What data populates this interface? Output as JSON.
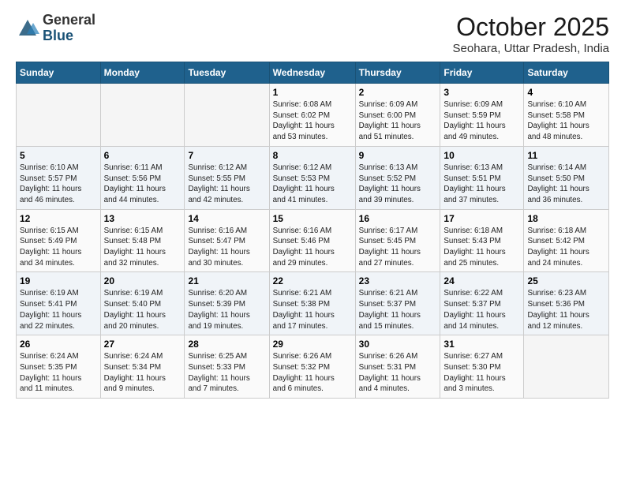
{
  "header": {
    "logo_general": "General",
    "logo_blue": "Blue",
    "month_title": "October 2025",
    "location": "Seohara, Uttar Pradesh, India"
  },
  "weekdays": [
    "Sunday",
    "Monday",
    "Tuesday",
    "Wednesday",
    "Thursday",
    "Friday",
    "Saturday"
  ],
  "weeks": [
    [
      {
        "day": "",
        "info": ""
      },
      {
        "day": "",
        "info": ""
      },
      {
        "day": "",
        "info": ""
      },
      {
        "day": "1",
        "info": "Sunrise: 6:08 AM\nSunset: 6:02 PM\nDaylight: 11 hours\nand 53 minutes."
      },
      {
        "day": "2",
        "info": "Sunrise: 6:09 AM\nSunset: 6:00 PM\nDaylight: 11 hours\nand 51 minutes."
      },
      {
        "day": "3",
        "info": "Sunrise: 6:09 AM\nSunset: 5:59 PM\nDaylight: 11 hours\nand 49 minutes."
      },
      {
        "day": "4",
        "info": "Sunrise: 6:10 AM\nSunset: 5:58 PM\nDaylight: 11 hours\nand 48 minutes."
      }
    ],
    [
      {
        "day": "5",
        "info": "Sunrise: 6:10 AM\nSunset: 5:57 PM\nDaylight: 11 hours\nand 46 minutes."
      },
      {
        "day": "6",
        "info": "Sunrise: 6:11 AM\nSunset: 5:56 PM\nDaylight: 11 hours\nand 44 minutes."
      },
      {
        "day": "7",
        "info": "Sunrise: 6:12 AM\nSunset: 5:55 PM\nDaylight: 11 hours\nand 42 minutes."
      },
      {
        "day": "8",
        "info": "Sunrise: 6:12 AM\nSunset: 5:53 PM\nDaylight: 11 hours\nand 41 minutes."
      },
      {
        "day": "9",
        "info": "Sunrise: 6:13 AM\nSunset: 5:52 PM\nDaylight: 11 hours\nand 39 minutes."
      },
      {
        "day": "10",
        "info": "Sunrise: 6:13 AM\nSunset: 5:51 PM\nDaylight: 11 hours\nand 37 minutes."
      },
      {
        "day": "11",
        "info": "Sunrise: 6:14 AM\nSunset: 5:50 PM\nDaylight: 11 hours\nand 36 minutes."
      }
    ],
    [
      {
        "day": "12",
        "info": "Sunrise: 6:15 AM\nSunset: 5:49 PM\nDaylight: 11 hours\nand 34 minutes."
      },
      {
        "day": "13",
        "info": "Sunrise: 6:15 AM\nSunset: 5:48 PM\nDaylight: 11 hours\nand 32 minutes."
      },
      {
        "day": "14",
        "info": "Sunrise: 6:16 AM\nSunset: 5:47 PM\nDaylight: 11 hours\nand 30 minutes."
      },
      {
        "day": "15",
        "info": "Sunrise: 6:16 AM\nSunset: 5:46 PM\nDaylight: 11 hours\nand 29 minutes."
      },
      {
        "day": "16",
        "info": "Sunrise: 6:17 AM\nSunset: 5:45 PM\nDaylight: 11 hours\nand 27 minutes."
      },
      {
        "day": "17",
        "info": "Sunrise: 6:18 AM\nSunset: 5:43 PM\nDaylight: 11 hours\nand 25 minutes."
      },
      {
        "day": "18",
        "info": "Sunrise: 6:18 AM\nSunset: 5:42 PM\nDaylight: 11 hours\nand 24 minutes."
      }
    ],
    [
      {
        "day": "19",
        "info": "Sunrise: 6:19 AM\nSunset: 5:41 PM\nDaylight: 11 hours\nand 22 minutes."
      },
      {
        "day": "20",
        "info": "Sunrise: 6:19 AM\nSunset: 5:40 PM\nDaylight: 11 hours\nand 20 minutes."
      },
      {
        "day": "21",
        "info": "Sunrise: 6:20 AM\nSunset: 5:39 PM\nDaylight: 11 hours\nand 19 minutes."
      },
      {
        "day": "22",
        "info": "Sunrise: 6:21 AM\nSunset: 5:38 PM\nDaylight: 11 hours\nand 17 minutes."
      },
      {
        "day": "23",
        "info": "Sunrise: 6:21 AM\nSunset: 5:37 PM\nDaylight: 11 hours\nand 15 minutes."
      },
      {
        "day": "24",
        "info": "Sunrise: 6:22 AM\nSunset: 5:37 PM\nDaylight: 11 hours\nand 14 minutes."
      },
      {
        "day": "25",
        "info": "Sunrise: 6:23 AM\nSunset: 5:36 PM\nDaylight: 11 hours\nand 12 minutes."
      }
    ],
    [
      {
        "day": "26",
        "info": "Sunrise: 6:24 AM\nSunset: 5:35 PM\nDaylight: 11 hours\nand 11 minutes."
      },
      {
        "day": "27",
        "info": "Sunrise: 6:24 AM\nSunset: 5:34 PM\nDaylight: 11 hours\nand 9 minutes."
      },
      {
        "day": "28",
        "info": "Sunrise: 6:25 AM\nSunset: 5:33 PM\nDaylight: 11 hours\nand 7 minutes."
      },
      {
        "day": "29",
        "info": "Sunrise: 6:26 AM\nSunset: 5:32 PM\nDaylight: 11 hours\nand 6 minutes."
      },
      {
        "day": "30",
        "info": "Sunrise: 6:26 AM\nSunset: 5:31 PM\nDaylight: 11 hours\nand 4 minutes."
      },
      {
        "day": "31",
        "info": "Sunrise: 6:27 AM\nSunset: 5:30 PM\nDaylight: 11 hours\nand 3 minutes."
      },
      {
        "day": "",
        "info": ""
      }
    ]
  ]
}
